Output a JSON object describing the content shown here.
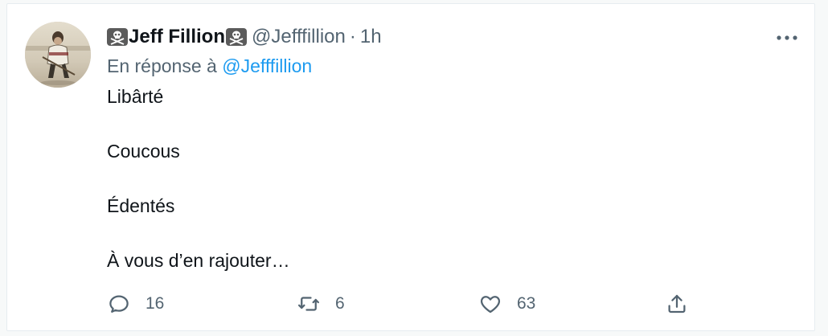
{
  "tweet": {
    "author_name": "Jeff Fillion",
    "author_handle": "@Jefffillion",
    "separator": "·",
    "timestamp": "1h",
    "reply_prefix": "En réponse à",
    "reply_mention": "@Jefffillion",
    "lines": [
      "Libârté",
      "Coucous",
      "Édentés",
      "À vous d’en rajouter…"
    ]
  },
  "actions": {
    "reply_count": "16",
    "retweet_count": "6",
    "like_count": "63"
  },
  "icons": {
    "badge": "skull-crossbones-icon",
    "more": "more-horizontal-icon",
    "reply": "reply-icon",
    "retweet": "retweet-icon",
    "like": "heart-icon",
    "share": "share-icon"
  },
  "colors": {
    "link": "#1d9bf0",
    "secondary_text": "#536471",
    "primary_text": "#0f1419"
  }
}
